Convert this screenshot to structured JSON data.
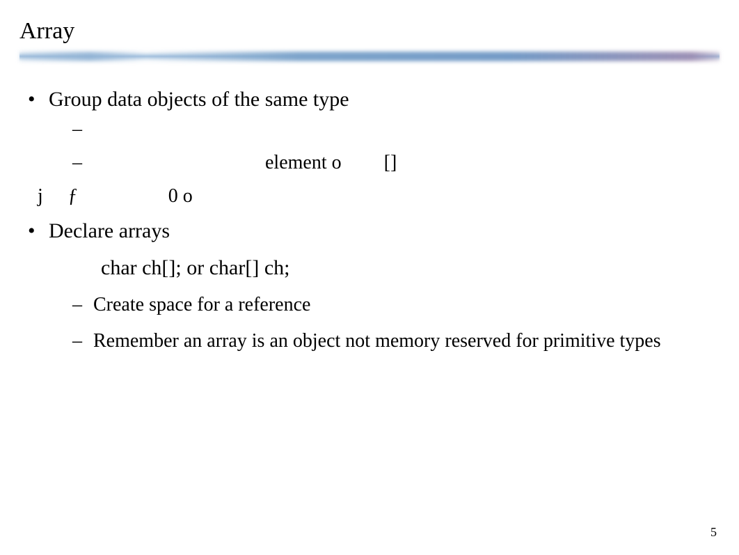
{
  "slide": {
    "title": "Array",
    "bullets": [
      {
        "text": "Group data objects of the same type",
        "sub_dashes": [
          "",
          {
            "element_label": "element o",
            "bracket_label": "[]"
          }
        ],
        "stray_line": {
          "a": "j",
          "b": "ƒ",
          "c": "0 o"
        }
      },
      {
        "text": "Declare arrays",
        "code": "char ch[]; or char[] ch;",
        "sub_dashes_text": [
          "Create space for a reference",
          "Remember an array is an object not memory reserved for primitive types"
        ]
      }
    ],
    "page_number": "5"
  }
}
